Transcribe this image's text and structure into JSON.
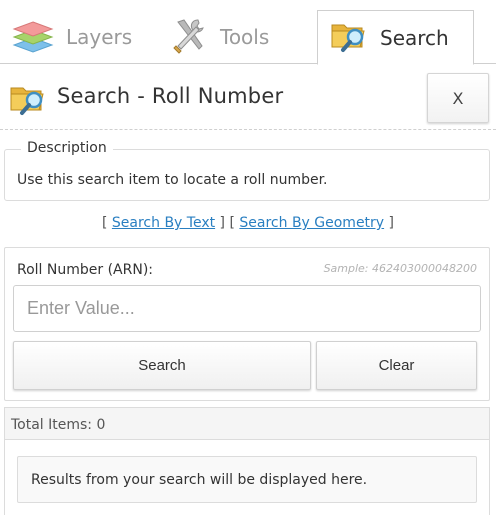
{
  "tabs": [
    {
      "label": "Layers",
      "icon": "layers-icon",
      "active": false
    },
    {
      "label": "Tools",
      "icon": "tools-icon",
      "active": false
    },
    {
      "label": "Search",
      "icon": "search-folder-icon",
      "active": true
    }
  ],
  "header": {
    "title": "Search - Roll Number",
    "close_label": "X"
  },
  "description": {
    "legend": "Description",
    "text": "Use this search item to locate a roll number."
  },
  "links": {
    "open_bracket_1": "[ ",
    "search_by_text": "Search By Text",
    "separator": " ] [ ",
    "search_by_geometry": "Search By Geometry",
    "close_bracket_2": " ]"
  },
  "form": {
    "field_label": "Roll Number (ARN):",
    "sample": "Sample: 462403000048200",
    "placeholder": "Enter Value...",
    "search_label": "Search",
    "clear_label": "Clear"
  },
  "results": {
    "total_label": "Total Items: 0",
    "message": "Results from your search will be displayed here."
  },
  "colors": {
    "link": "#2a7fc1",
    "border": "#dcdcdc",
    "muted_text": "#9a9a9a"
  }
}
